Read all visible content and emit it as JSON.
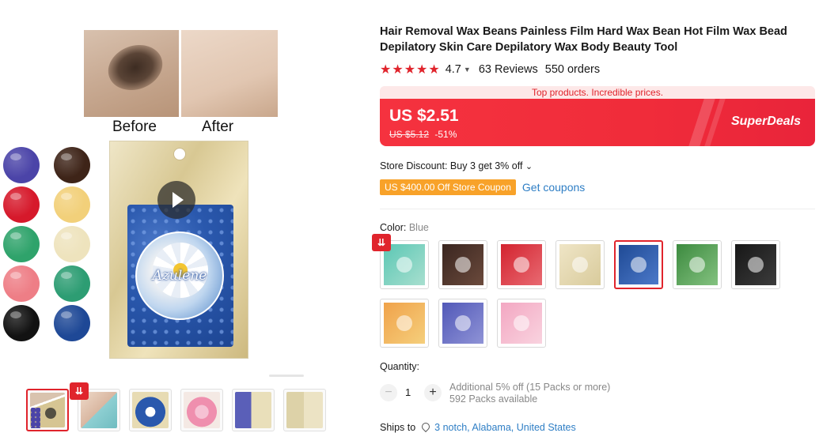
{
  "product": {
    "title": "Hair Removal Wax Beans Painless Film Hard Wax Bean Hot Film Wax Bead Depilatory Skin Care Depilatory Wax Body Beauty Tool",
    "stars": "★★★★★",
    "rating": "4.7",
    "reviews": "63 Reviews",
    "orders": "550 orders"
  },
  "gallery": {
    "before_label": "Before",
    "after_label": "After",
    "brand_label": "Azulene",
    "swatch_colors": [
      "#4b44a8",
      "#3e2418",
      "#d6192b",
      "#f2d07a",
      "#2fa36b",
      "#eee3bd",
      "#ee7e86",
      "#2d9d73",
      "#121212",
      "#1e4896"
    ],
    "thumbnails": [
      "main",
      "applying-wax",
      "blue-pack",
      "pink-pack",
      "purple-pack",
      "white-pack"
    ],
    "drop_badge": "⇊"
  },
  "pricing": {
    "promo_text": "Top products. Incredible prices.",
    "current_price": "US $2.51",
    "original_price": "US $5.12",
    "discount": "-51%",
    "superdeals": "SuperDeals"
  },
  "store": {
    "discount_text": "Store Discount: Buy 3 get 3% off",
    "chevron": "⌄",
    "coupon_tag": "US $400.00 Off Store Coupon",
    "get_coupons": "Get coupons"
  },
  "color": {
    "label": "Color:",
    "selected": "Blue",
    "options": [
      {
        "name": "teal",
        "color": "#5bc7b4",
        "accent": "#a8dfcf"
      },
      {
        "name": "coffee",
        "color": "#3a2620",
        "accent": "#6b4a3c"
      },
      {
        "name": "red",
        "color": "#d3232f",
        "accent": "#e86a72"
      },
      {
        "name": "cream",
        "color": "#efe5c6",
        "accent": "#d9cb9c"
      },
      {
        "name": "blue",
        "color": "#1f4a95",
        "accent": "#4c79c9"
      },
      {
        "name": "green",
        "color": "#3c8a3f",
        "accent": "#84c280"
      },
      {
        "name": "black",
        "color": "#171717",
        "accent": "#3c3c3c"
      },
      {
        "name": "yellow",
        "color": "#f0a24a",
        "accent": "#f5cf7c"
      },
      {
        "name": "purple",
        "color": "#5158b8",
        "accent": "#8f93d6"
      },
      {
        "name": "pink",
        "color": "#f3a7c2",
        "accent": "#f9d3df"
      }
    ]
  },
  "quantity": {
    "label": "Quantity:",
    "minus": "−",
    "plus": "+",
    "value": "1",
    "note_line1": "Additional 5% off (15 Packs or more)",
    "note_line2": "592 Packs available"
  },
  "shipping": {
    "label": "Ships to",
    "destination": "3 notch, Alabama, United States"
  }
}
